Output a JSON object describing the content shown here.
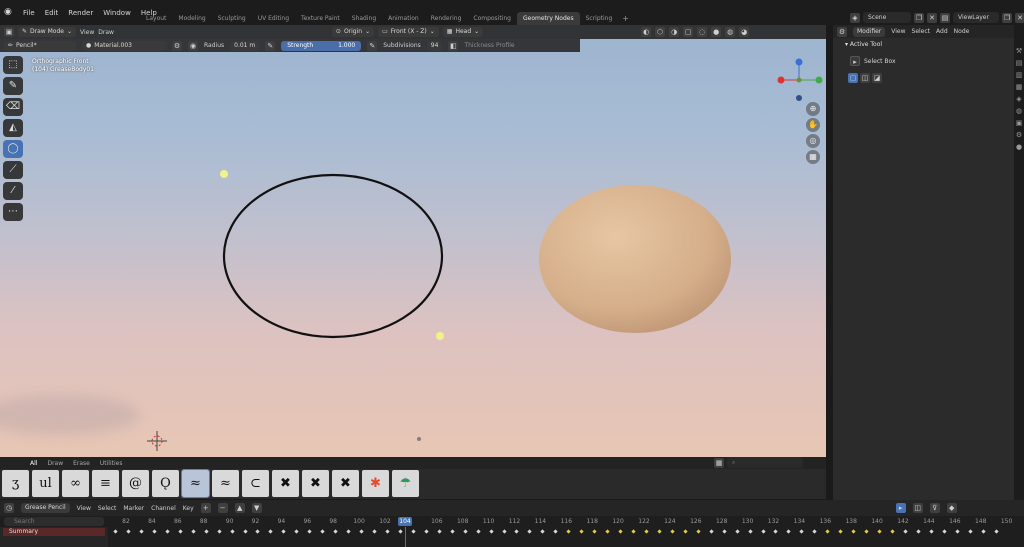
{
  "menu": [
    "File",
    "Edit",
    "Render",
    "Window",
    "Help"
  ],
  "workspaces": [
    {
      "label": "Layout",
      "active": false
    },
    {
      "label": "Modeling",
      "active": false
    },
    {
      "label": "Sculpting",
      "active": false
    },
    {
      "label": "UV Editing",
      "active": false
    },
    {
      "label": "Texture Paint",
      "active": false
    },
    {
      "label": "Shading",
      "active": false
    },
    {
      "label": "Animation",
      "active": false
    },
    {
      "label": "Rendering",
      "active": false
    },
    {
      "label": "Compositing",
      "active": false
    },
    {
      "label": "Geometry Nodes",
      "active": true
    },
    {
      "label": "Scripting",
      "active": false
    }
  ],
  "scene": {
    "scene_label": "Scene",
    "view_layer_label": "ViewLayer"
  },
  "viewport_header": {
    "mode": "Draw Mode",
    "view": "View",
    "draw": "Draw",
    "origin": "Origin",
    "front": "Front (X - Z)",
    "head": "Head"
  },
  "tool_header": {
    "brush": "Pencil*",
    "material": "Material.003",
    "radius_label": "Radius",
    "radius_value": "0.01 m",
    "strength_label": "Strength",
    "strength_value": "1.000",
    "subdivisions_label": "Subdivisions",
    "subdivisions_value": "94",
    "thickness_profile": "Thickness Profile"
  },
  "view_info": {
    "line1": "Orthographic Front",
    "line2": "(104) GreaseBody01"
  },
  "brush_tabs": [
    {
      "label": "All",
      "active": true
    },
    {
      "label": "Draw",
      "active": false
    },
    {
      "label": "Erase",
      "active": false
    },
    {
      "label": "Utilities",
      "active": false
    }
  ],
  "brushes": [
    "ʒ",
    "ul",
    "∞",
    "≡",
    "@",
    "Ǫ",
    "≈",
    "≈",
    "⊂",
    "✖",
    "✖",
    "✖",
    "✱",
    "☂"
  ],
  "right_panel": {
    "editor": "Modifier",
    "menus": [
      "View",
      "Select",
      "Add",
      "Node"
    ],
    "active_tool": "Active Tool",
    "select_box": "Select Box"
  },
  "timeline": {
    "editor": "Grease Pencil",
    "menus": [
      "View",
      "Select",
      "Marker",
      "Channel",
      "Key"
    ],
    "search_placeholder": "Search",
    "summary": "Summary",
    "current_frame": "104",
    "frames": [
      "82",
      "84",
      "86",
      "88",
      "90",
      "92",
      "94",
      "96",
      "98",
      "100",
      "102",
      "104",
      "106",
      "108",
      "110",
      "112",
      "114",
      "116",
      "118",
      "120",
      "122",
      "124",
      "126",
      "128",
      "130",
      "132",
      "134",
      "136",
      "138",
      "140",
      "142",
      "144",
      "146",
      "148",
      "150"
    ]
  },
  "colors": {
    "accent": "#4772b3",
    "active_tab": "#3a3a3a"
  }
}
